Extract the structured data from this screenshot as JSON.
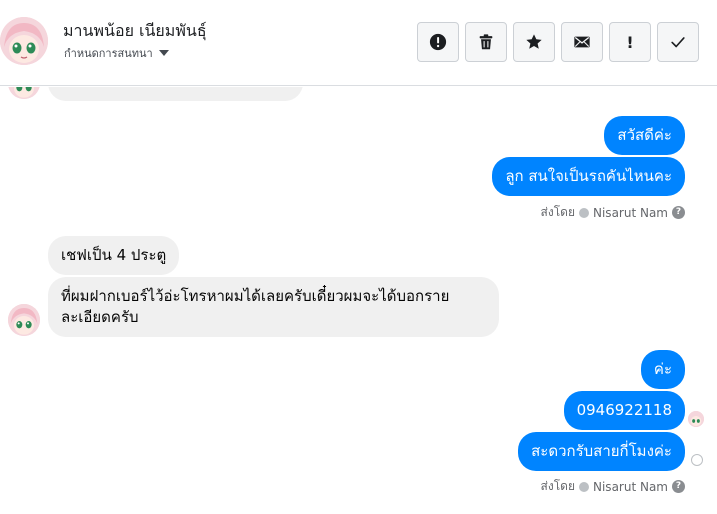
{
  "header": {
    "contact_name": "มานพน้อย เนียมพันธุ์",
    "label_select": "กำหนดการสนทนา"
  },
  "toolbar": {
    "buttons": [
      {
        "name": "spam",
        "icon": "exclamation-circle-icon"
      },
      {
        "name": "delete",
        "icon": "trash-icon"
      },
      {
        "name": "star",
        "icon": "star-icon"
      },
      {
        "name": "mark-unread",
        "icon": "envelope-icon",
        "glyph": "✉"
      },
      {
        "name": "follow-up",
        "icon": "exclamation-icon",
        "glyph": "!"
      },
      {
        "name": "done",
        "icon": "check-icon"
      }
    ]
  },
  "messages": {
    "m0": "",
    "m1": "สวัสดีค่ะ",
    "m2": "ลูก สนใจเป็นรถคันไหนคะ",
    "m3": "เชฟเป็น 4 ประตู",
    "m4_line1": "ที่ผมฝากเบอร์ไว้อ่ะโทรหาผมได้เลยครับเดี๋ยวผมจะได้บอกราย",
    "m4_line2": "ละเอียดครับ",
    "m5": "ค่ะ",
    "m6": "0946922118",
    "m7": "สะดวกรับสายกี่โมงค่ะ"
  },
  "sent_by": {
    "prefix": "ส่งโดย",
    "name": "Nisarut Nam",
    "help": "?"
  },
  "colors": {
    "outgoing_bubble": "#0084ff",
    "incoming_bubble": "#f0f0f0",
    "muted_text": "#65676b"
  }
}
